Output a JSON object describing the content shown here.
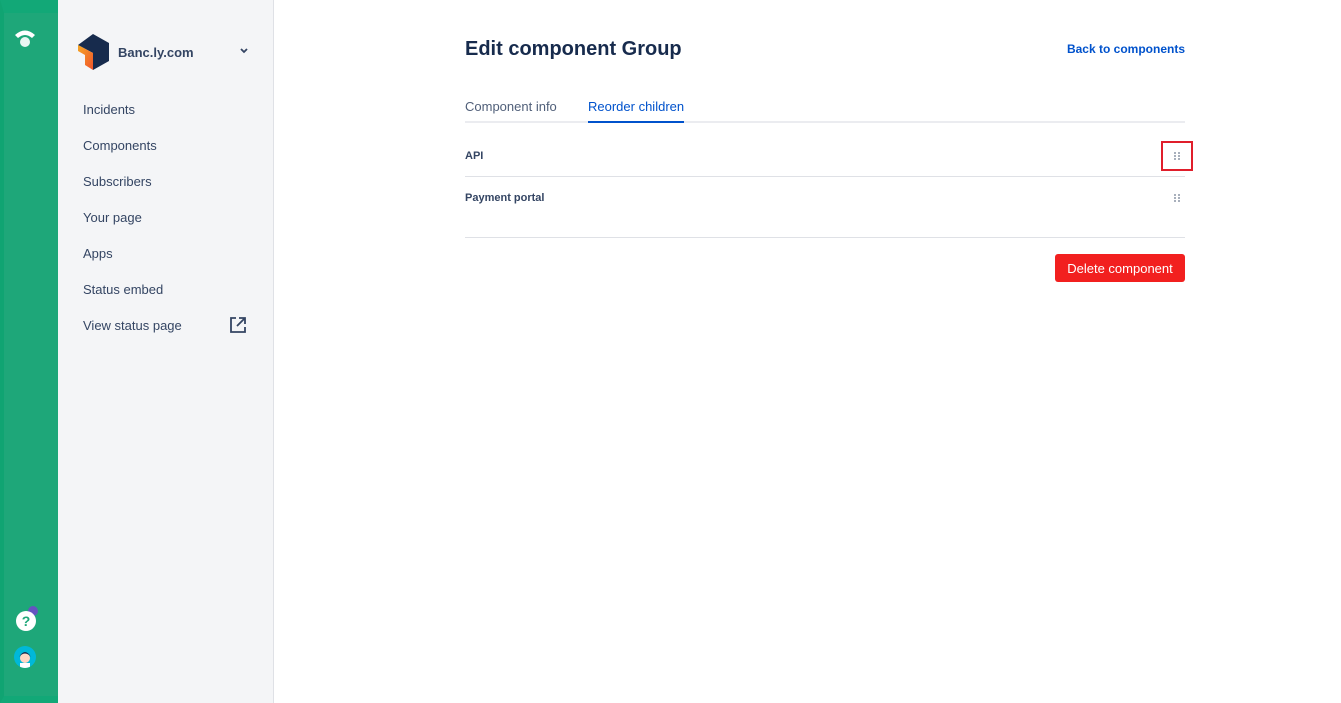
{
  "org": {
    "name": "Banc.ly.com"
  },
  "sidebar": {
    "items": [
      {
        "label": "Incidents"
      },
      {
        "label": "Components"
      },
      {
        "label": "Subscribers"
      },
      {
        "label": "Your page"
      },
      {
        "label": "Apps"
      },
      {
        "label": "Status embed"
      },
      {
        "label": "View status page",
        "icon": "external-link-icon"
      }
    ]
  },
  "rail": {
    "help_label": "?"
  },
  "header": {
    "title": "Edit component Group",
    "back_link": "Back to components"
  },
  "tabs": [
    {
      "label": "Component info",
      "active": false
    },
    {
      "label": "Reorder children",
      "active": true
    }
  ],
  "children": [
    {
      "name": "API",
      "handle_icon": "drag-handle-icon",
      "highlighted": true
    },
    {
      "name": "Payment portal",
      "handle_icon": "drag-handle-icon",
      "highlighted": false
    }
  ],
  "actions": {
    "delete_label": "Delete component"
  },
  "colors": {
    "rail": "#1ea779",
    "accent": "#0052cc",
    "danger": "#f2201f",
    "highlight": "#e01e2b"
  }
}
